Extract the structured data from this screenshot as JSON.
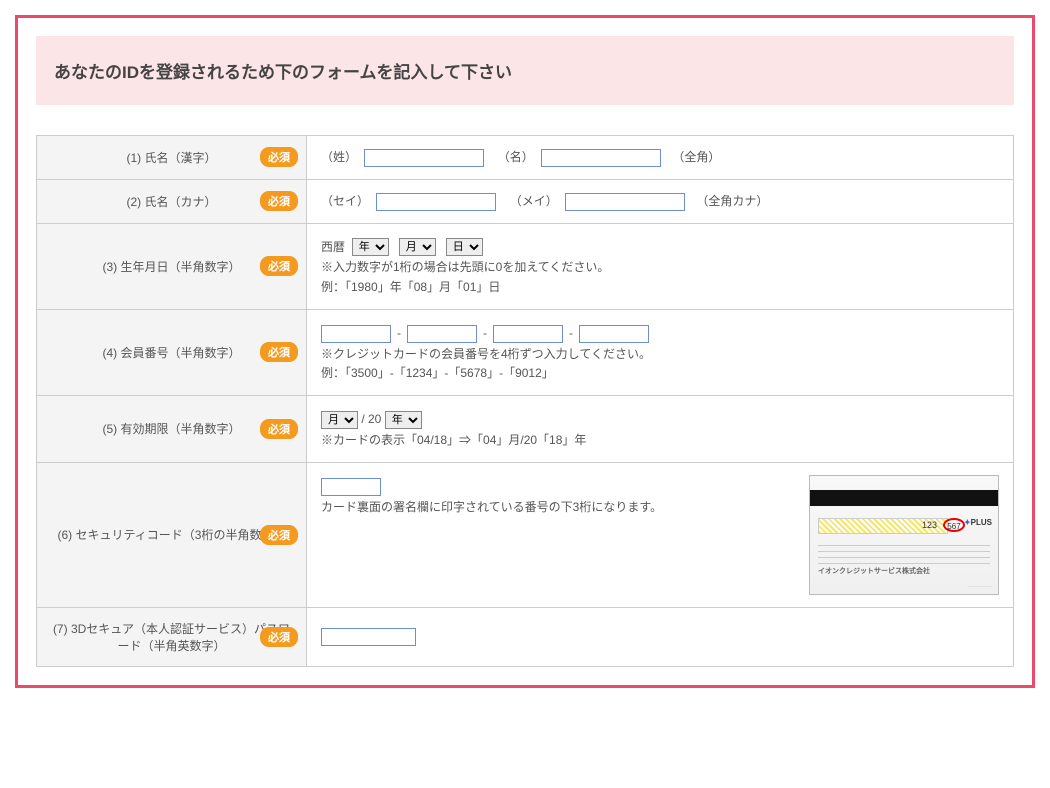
{
  "header": {
    "title": "あなたのIDを登録されるため下のフォームを記入して下さい"
  },
  "required_label": "必須",
  "rows": {
    "name_kanji": {
      "label": "(1) 氏名（漢字）",
      "sei": "（姓）",
      "mei": "（名）",
      "note": "（全角）"
    },
    "name_kana": {
      "label": "(2) 氏名（カナ）",
      "sei": "（セイ）",
      "mei": "（メイ）",
      "note": "（全角カナ）"
    },
    "birth": {
      "label": "(3) 生年月日（半角数字）",
      "seireki": "西暦",
      "year": "年",
      "month": "月",
      "day": "日",
      "hint1": "※入力数字が1桁の場合は先頭に0を加えてください。",
      "hint2": "例：「1980」年「08」月「01」日"
    },
    "member_no": {
      "label": "(4) 会員番号（半角数字）",
      "dash": "-",
      "hint1": "※クレジットカードの会員番号を4桁ずつ入力してください。",
      "hint2": "例：「3500」-「1234」-「5678」-「9012」"
    },
    "expiry": {
      "label": "(5) 有効期限（半角数字）",
      "month": "月",
      "slash20": "/ 20",
      "year": "年",
      "hint": "※カードの表示「04/18」⇒「04」月/20「18」年"
    },
    "cvv": {
      "label": "(6) セキュリティコード（3桁の半角数字）",
      "hint": "カード裏面の署名欄に印字されている番号の下3桁になります。",
      "card_num": "123",
      "card_cvv": "567",
      "card_plus": "PLUS",
      "card_brand": "イオンクレジットサービス株式会社"
    },
    "secure": {
      "label": "(7) 3Dセキュア（本人認証サービス）パスワード（半角英数字）"
    }
  }
}
